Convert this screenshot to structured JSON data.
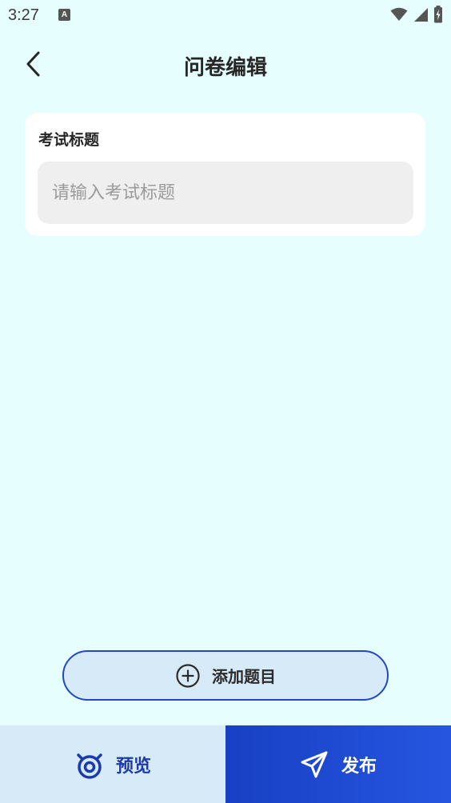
{
  "status_bar": {
    "time": "3:27",
    "notification_icon_letter": "A",
    "icons": [
      "wifi-icon",
      "cell-signal-icon",
      "battery-charging-icon"
    ]
  },
  "header": {
    "back_icon": "chevron-left-icon",
    "title": "问卷编辑"
  },
  "title_card": {
    "label": "考试标题",
    "input_value": "",
    "input_placeholder": "请输入考试标题"
  },
  "add_question": {
    "icon": "plus-circle-icon",
    "label": "添加题目"
  },
  "bottom_bar": {
    "preview_icon": "eye-icon",
    "preview_label": "预览",
    "publish_icon": "paper-plane-icon",
    "publish_label": "发布"
  },
  "colors": {
    "background": "#E6FEFE",
    "card": "#FFFFFF",
    "input_bg": "#EFEFEF",
    "accent_blue": "#1C3AAE",
    "light_blue": "#D6EAF8",
    "publish_bg": "#1F4AD0"
  }
}
